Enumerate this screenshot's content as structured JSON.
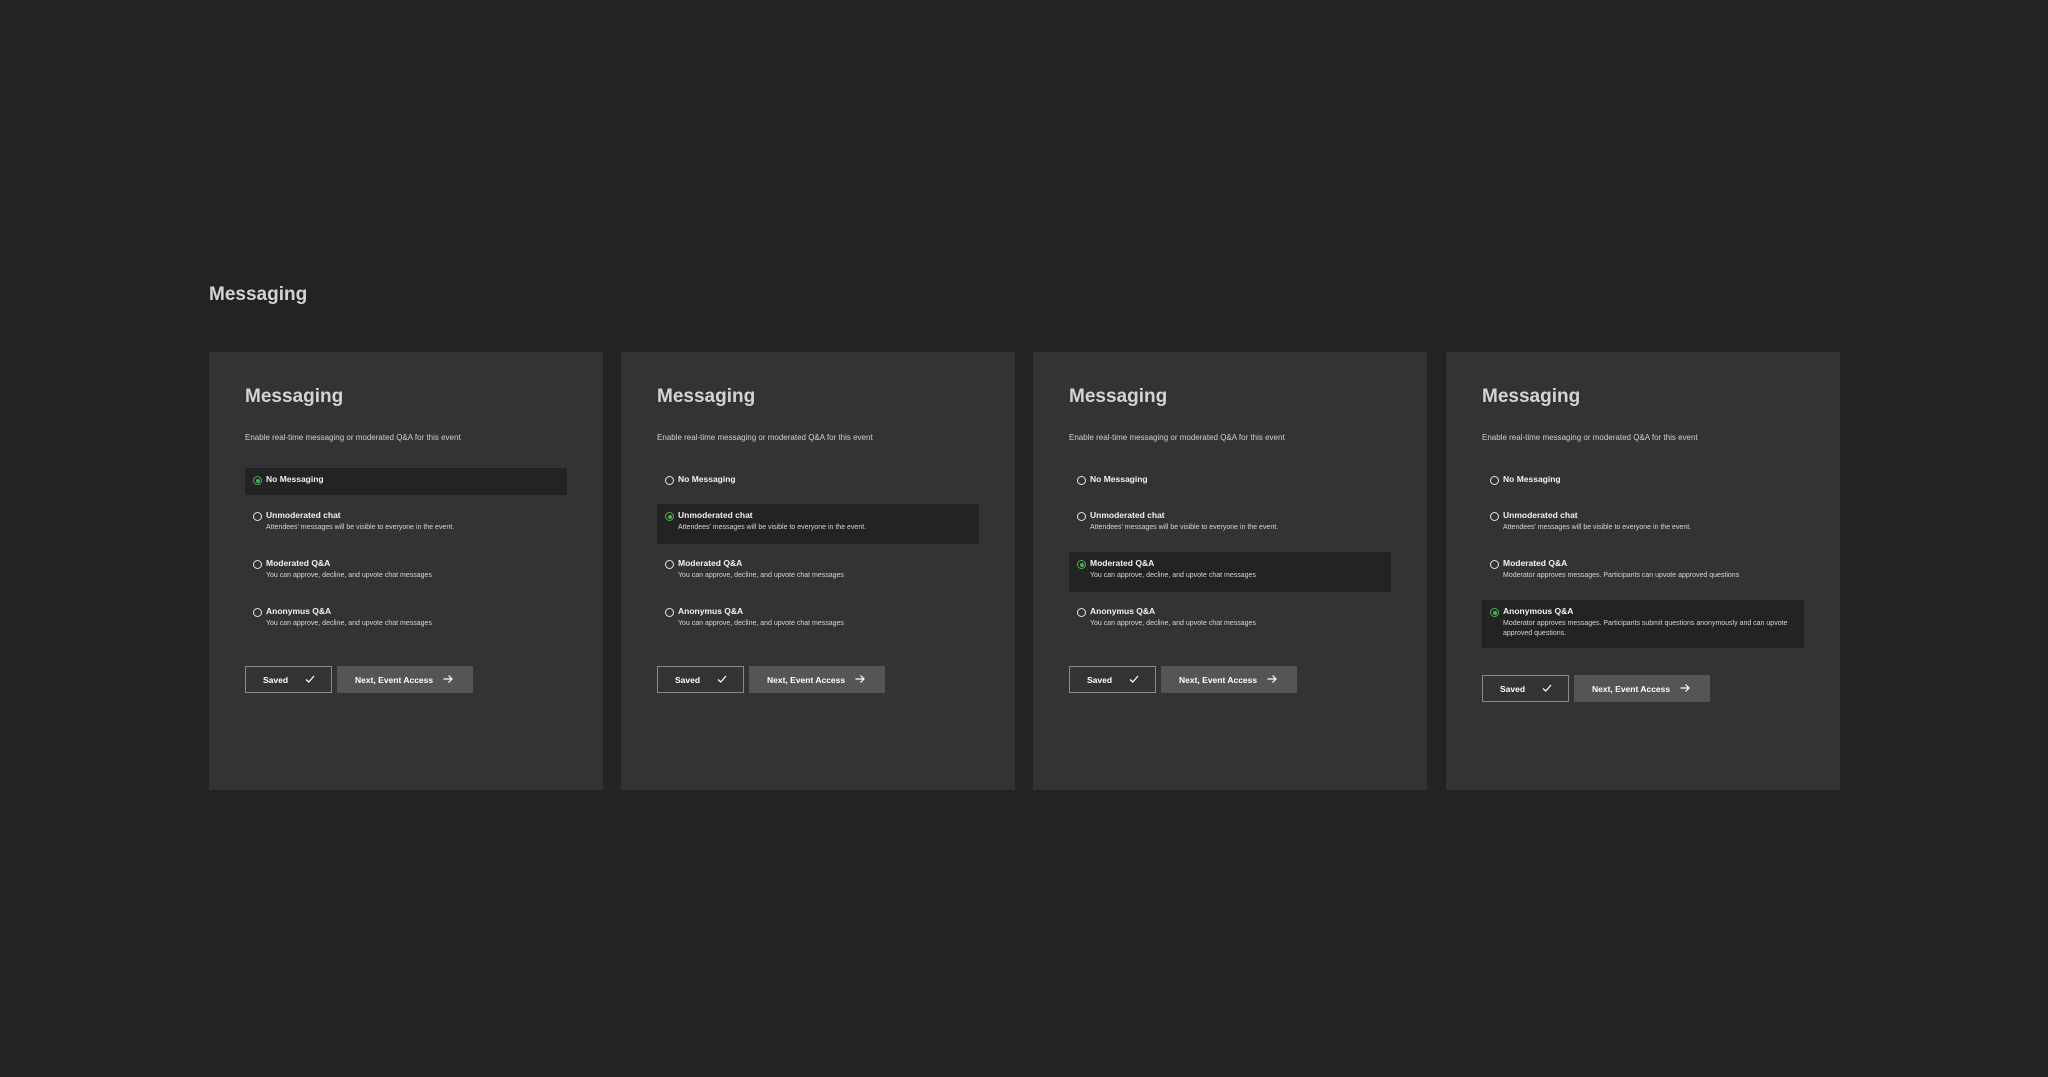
{
  "page": {
    "heading": "Messaging"
  },
  "cards": [
    {
      "title": "Messaging",
      "subtitle": "Enable real-time messaging or moderated Q&A for this event",
      "options": [
        {
          "label": "No Messaging",
          "desc": "",
          "selected": true
        },
        {
          "label": "Unmoderated chat",
          "desc": "Attendees' messages will be visible to everyone in the event.",
          "selected": false
        },
        {
          "label": "Moderated Q&A",
          "desc": "You can approve, decline, and upvote chat messages",
          "selected": false
        },
        {
          "label": "Anonymus Q&A",
          "desc": "You can approve, decline, and upvote chat messages",
          "selected": false
        }
      ],
      "saved_label": "Saved",
      "next_label": "Next, Event Access"
    },
    {
      "title": "Messaging",
      "subtitle": "Enable real-time messaging or moderated Q&A for this event",
      "options": [
        {
          "label": "No Messaging",
          "desc": "",
          "selected": false
        },
        {
          "label": "Unmoderated chat",
          "desc": "Attendees' messages will be visible to everyone in the event.",
          "selected": true
        },
        {
          "label": "Moderated Q&A",
          "desc": "You can approve, decline, and upvote chat messages",
          "selected": false
        },
        {
          "label": "Anonymus Q&A",
          "desc": "You can approve, decline, and upvote chat messages",
          "selected": false
        }
      ],
      "saved_label": "Saved",
      "next_label": "Next, Event Access"
    },
    {
      "title": "Messaging",
      "subtitle": "Enable real-time messaging or moderated Q&A for this event",
      "options": [
        {
          "label": "No Messaging",
          "desc": "",
          "selected": false
        },
        {
          "label": "Unmoderated chat",
          "desc": "Attendees' messages will be visible to everyone in the event.",
          "selected": false
        },
        {
          "label": "Moderated Q&A",
          "desc": "You can approve, decline, and upvote chat messages",
          "selected": true
        },
        {
          "label": "Anonymus Q&A",
          "desc": "You can approve, decline, and upvote chat messages",
          "selected": false
        }
      ],
      "saved_label": "Saved",
      "next_label": "Next, Event Access"
    },
    {
      "title": "Messaging",
      "subtitle": "Enable real-time messaging or moderated Q&A for this event",
      "options": [
        {
          "label": "No Messaging",
          "desc": "",
          "selected": false
        },
        {
          "label": "Unmoderated chat",
          "desc": "Attendees' messages will be visible to everyone in the event.",
          "selected": false
        },
        {
          "label": "Moderated Q&A",
          "desc": "Moderator approves messages. Participants can upvote approved questions",
          "selected": false
        },
        {
          "label": "Anonymous Q&A",
          "desc": "Moderator approves messages. Participants submit questions anonymously and can upvote approved questions.",
          "selected": true
        }
      ],
      "saved_label": "Saved",
      "next_label": "Next, Event Access"
    }
  ],
  "icons": {
    "saved": "check-icon",
    "next": "arrow-right-icon"
  },
  "colors": {
    "background": "#232323",
    "card": "#333333",
    "selected_row": "#232323",
    "radio_on": "#4caf50",
    "next_button": "#555555"
  }
}
